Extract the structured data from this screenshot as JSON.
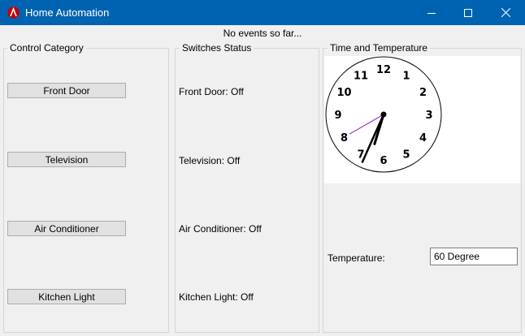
{
  "window": {
    "title": "Home Automation",
    "icon": "app-logo-icon",
    "controls": [
      "minimize-icon",
      "maximize-icon",
      "close-icon"
    ]
  },
  "events_text": "No events so far...",
  "control_category": {
    "title": "Control Category",
    "buttons": [
      "Front Door",
      "Television",
      "Air Conditioner",
      "Kitchen Light"
    ]
  },
  "switches_status": {
    "title": "Switches Status",
    "items": [
      "Front Door: Off",
      "Television: Off",
      "Air Conditioner: Off",
      "Kitchen Light: Off"
    ]
  },
  "time_temp": {
    "title": "Time and Temperature",
    "clock": {
      "numbers": [
        "12",
        "1",
        "2",
        "3",
        "4",
        "5",
        "6",
        "7",
        "8",
        "9",
        "10",
        "11"
      ],
      "hour": 6,
      "minute": 34,
      "second": 40
    },
    "temperature_label": "Temperature:",
    "temperature_value": "60 Degree"
  },
  "colors": {
    "titlebar": "#0063b1",
    "second_hand": "#8000c0"
  }
}
